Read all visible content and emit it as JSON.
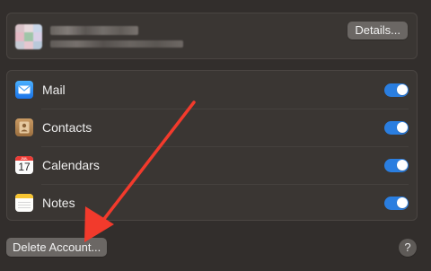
{
  "account": {
    "details_label": "Details..."
  },
  "apps": [
    {
      "label": "Mail",
      "icon": "mail-icon",
      "enabled": true
    },
    {
      "label": "Contacts",
      "icon": "contacts-icon",
      "enabled": true
    },
    {
      "label": "Calendars",
      "icon": "calendar-icon",
      "enabled": true,
      "calendar_day": "17",
      "calendar_month": "JUL"
    },
    {
      "label": "Notes",
      "icon": "notes-icon",
      "enabled": true
    }
  ],
  "footer": {
    "delete_label": "Delete Account...",
    "help_label": "?"
  },
  "colors": {
    "background": "#322e2c",
    "card": "#3a3633",
    "toggle_on": "#2a7ee0",
    "button": "#6b6764",
    "annotation_arrow": "#f23a2c"
  }
}
